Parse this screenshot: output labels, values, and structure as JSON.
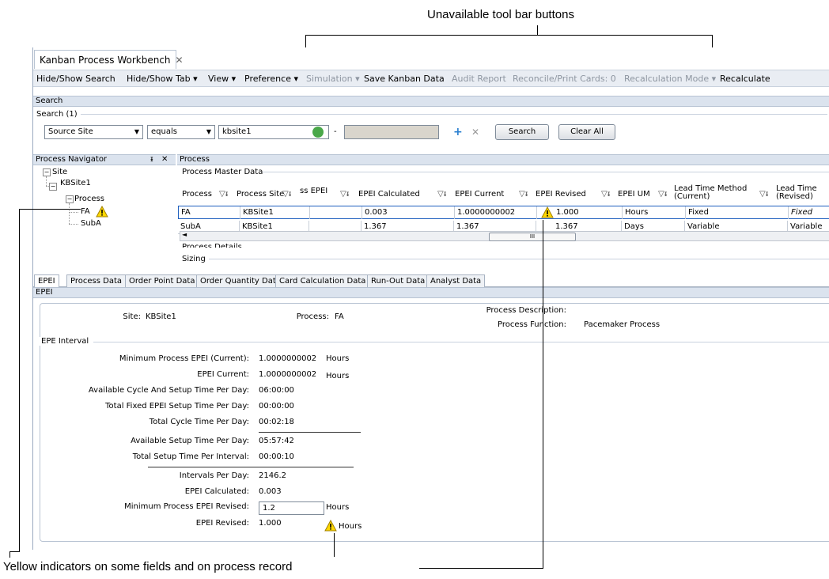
{
  "callouts": {
    "top": "Unavailable tool bar buttons",
    "bottom": "Yellow indicators on some fields and on process record"
  },
  "window": {
    "doc_tab": "Kanban Process Workbench",
    "close": "✕"
  },
  "menubar": {
    "items": [
      {
        "label": "Hide/Show Search"
      },
      {
        "label": "Hide/Show Tab ▾"
      },
      {
        "label": "View ▾"
      },
      {
        "label": "Preference ▾"
      },
      {
        "label": "Simulation ▾"
      },
      {
        "label": "Save Kanban Data"
      },
      {
        "label": "Audit Report"
      },
      {
        "label": "Reconcile/Print Cards: 0"
      },
      {
        "label": "Recalculation Mode ▾"
      },
      {
        "label": "Recalculate"
      }
    ]
  },
  "search": {
    "header": "Search",
    "group": "Search (1)",
    "field": "Source Site",
    "operator": "equals",
    "value": "kbsite1",
    "dash": "-",
    "search_btn": "Search",
    "clear_btn": "Clear All"
  },
  "navigator": {
    "title": "Process Navigator",
    "pin": "📌",
    "close": "✕",
    "nodes": [
      "Site",
      "KBSite1",
      "Process",
      "FA",
      "SubA"
    ],
    "collapse": "−"
  },
  "process": {
    "header": "Process",
    "master": "Process Master Data",
    "columns": [
      "Process",
      "Process Site",
      "ss EPEI",
      "EPEI Calculated",
      "EPEI Current",
      "EPEI Revised",
      "EPEI UM",
      "Lead Time Method (Current)",
      "Lead Time (Revised)"
    ],
    "col_sub": [
      "",
      "",
      "",
      "",
      "",
      "",
      "",
      "",
      ""
    ],
    "rows": [
      [
        "FA",
        "KBSite1",
        "",
        "0.003",
        "1.0000000002",
        "1.000",
        "Hours",
        "Fixed",
        "Fixed"
      ],
      [
        "SubA",
        "KBSite1",
        "",
        "1.367",
        "1.367",
        "1.367",
        "Days",
        "Variable",
        "Variable"
      ]
    ],
    "scroll_thumb": "III",
    "details": "Process Details",
    "sizing": "Sizing"
  },
  "tabs": [
    "EPEI",
    "Process Data",
    "Order Point Data",
    "Order Quantity Data",
    "Card Calculation Data",
    "Run-Out Data",
    "Analyst Data"
  ],
  "epei": {
    "header": "EPEI",
    "site_label": "Site:",
    "site_value": "KBSite1",
    "process_label": "Process:",
    "process_value": "FA",
    "desc_label": "Process Description:",
    "func_label": "Process Function:",
    "func_value": "Pacemaker Process",
    "interval_group": "EPE Interval",
    "rows": [
      {
        "label": "Minimum Process EPEI (Current):",
        "value": "1.0000000002",
        "unit": "Hours"
      },
      {
        "label": "EPEI Current:",
        "value": "1.0000000002",
        "unit": "Hours"
      },
      {
        "label": "Available Cycle And Setup Time Per Day:",
        "value": "06:00:00",
        "unit": ""
      },
      {
        "label": "Total Fixed EPEI Setup Time Per Day:",
        "value": "00:00:00",
        "unit": ""
      },
      {
        "label": "Total Cycle Time Per Day:",
        "value": "00:02:18",
        "unit": ""
      },
      {
        "label": "Available Setup Time Per Day:",
        "value": "05:57:42",
        "unit": ""
      },
      {
        "label": "Total Setup Time Per Interval:",
        "value": "00:00:10",
        "unit": ""
      },
      {
        "label": "Intervals Per Day:",
        "value": "2146.2",
        "unit": ""
      },
      {
        "label": "EPEI Calculated:",
        "value": "0.003",
        "unit": ""
      },
      {
        "label": "Minimum Process EPEI Revised:",
        "value": "1.2",
        "unit": "Hours"
      },
      {
        "label": "EPEI Revised:",
        "value": "1.000",
        "unit": "Hours"
      }
    ]
  },
  "colors": {
    "accent_bar": "#dbe3ee",
    "warning": "#ffd800",
    "disabled_text": "#8e96a1"
  }
}
